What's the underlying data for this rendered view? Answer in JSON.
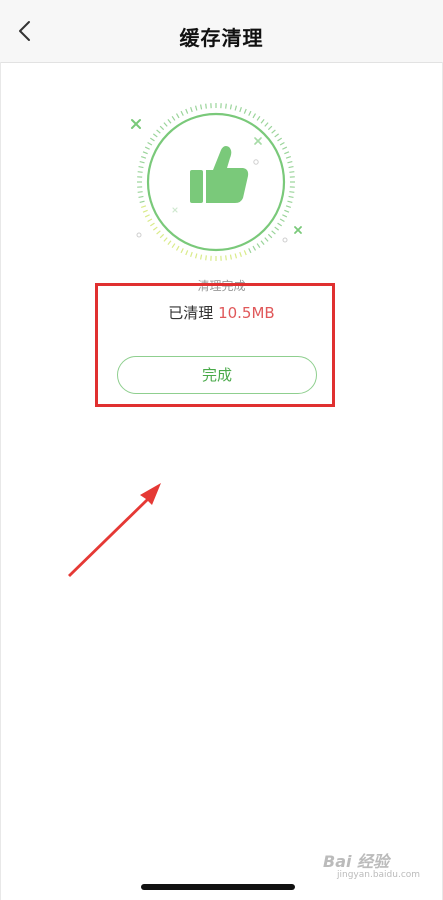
{
  "header": {
    "title": "缓存清理"
  },
  "result": {
    "status": "清理完成",
    "cleaned_prefix": "已清理",
    "cleaned_amount": "10.5MB",
    "done_label": "完成"
  },
  "colors": {
    "accent_green": "#7ac97a",
    "amount_red": "#e0585a",
    "annotation_red": "#e03030"
  },
  "watermark": {
    "main": "Bai 经验",
    "sub": "jingyan.baidu.com"
  }
}
